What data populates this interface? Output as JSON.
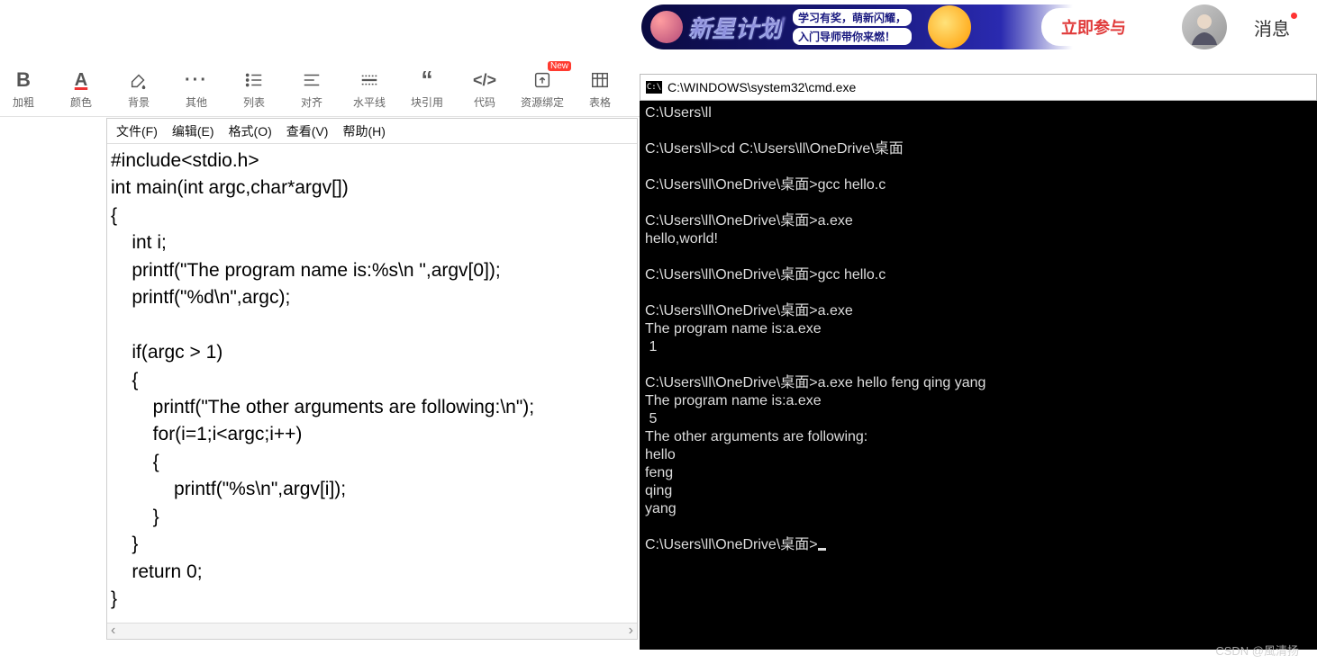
{
  "header": {
    "banner": {
      "title": "新星计划",
      "line1": "学习有奖，萌新闪耀，",
      "line2": "入门导师带你来燃！",
      "cta": "立即参与"
    },
    "msg_label": "消息"
  },
  "toolbar": {
    "items": [
      {
        "name": "bold",
        "label": "加粗",
        "glyph": "B"
      },
      {
        "name": "color",
        "label": "颜色",
        "glyph": "A"
      },
      {
        "name": "bg",
        "label": "背景",
        "glyph": "bg"
      },
      {
        "name": "misc",
        "label": "其他",
        "glyph": "..."
      },
      {
        "name": "list",
        "label": "列表",
        "glyph": "list"
      },
      {
        "name": "align",
        "label": "对齐",
        "glyph": "align"
      },
      {
        "name": "hr",
        "label": "水平线",
        "glyph": "hr"
      },
      {
        "name": "quote",
        "label": "块引用",
        "glyph": "quote"
      },
      {
        "name": "code",
        "label": "代码",
        "glyph": "code"
      },
      {
        "name": "resource",
        "label": "资源绑定",
        "glyph": "upload",
        "badge": "New"
      },
      {
        "name": "table",
        "label": "表格",
        "glyph": "table"
      }
    ]
  },
  "editor": {
    "menu": [
      "文件(F)",
      "编辑(E)",
      "格式(O)",
      "查看(V)",
      "帮助(H)"
    ],
    "code": "#include<stdio.h>\nint main(int argc,char*argv[])\n{\n    int i;\n    printf(\"The program name is:%s\\n \",argv[0]);\n    printf(\"%d\\n\",argc);\n\n    if(argc > 1)\n    {\n        printf(\"The other arguments are following:\\n\");\n        for(i=1;i<argc;i++)\n        {\n            printf(\"%s\\n\",argv[i]);\n        }\n    }\n    return 0;\n}"
  },
  "cmd": {
    "title_prefix": "C:\\\\",
    "title": "C:\\WINDOWS\\system32\\cmd.exe",
    "body": "C:\\Users\\ll\n\nC:\\Users\\ll>cd C:\\Users\\ll\\OneDrive\\桌面\n\nC:\\Users\\ll\\OneDrive\\桌面>gcc hello.c\n\nC:\\Users\\ll\\OneDrive\\桌面>a.exe\nhello,world!\n\nC:\\Users\\ll\\OneDrive\\桌面>gcc hello.c\n\nC:\\Users\\ll\\OneDrive\\桌面>a.exe\nThe program name is:a.exe\n 1\n\nC:\\Users\\ll\\OneDrive\\桌面>a.exe hello feng qing yang\nThe program name is:a.exe\n 5\nThe other arguments are following:\nhello\nfeng\nqing\nyang\n\nC:\\Users\\ll\\OneDrive\\桌面>"
  },
  "watermark": "CSDN @風清扬"
}
